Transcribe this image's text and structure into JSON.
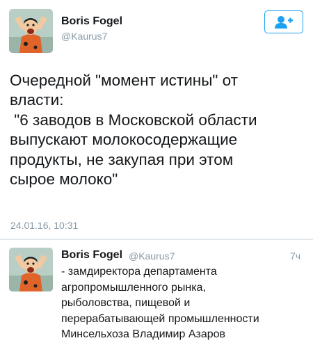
{
  "main_tweet": {
    "author_name": "Boris Fogel",
    "author_handle": "@Kaurus7",
    "follow_icon": "add-user-icon",
    "text": "Очередной \"момент истины\" от\nвласти:\n \"6 заводов в Московской области\nвыпускают молокосодержащие\nпродукты, не закупая при этом\nсырое молоко\"",
    "timestamp": "24.01.16, 10:31"
  },
  "reply_tweet": {
    "author_name": "Boris Fogel",
    "author_handle": "@Kaurus7",
    "time_ago": "7ч",
    "text": "- замдиректора департамента\nагропромышленного рынка,\nрыболовства, пищевой и\nперерабатывающей промышленности\nМинсельхоза Владимир Азаров"
  },
  "colors": {
    "accent": "#1da1f2",
    "secondary_text": "#8899a6",
    "primary_text": "#14171a",
    "divider": "#e1e8ed"
  }
}
